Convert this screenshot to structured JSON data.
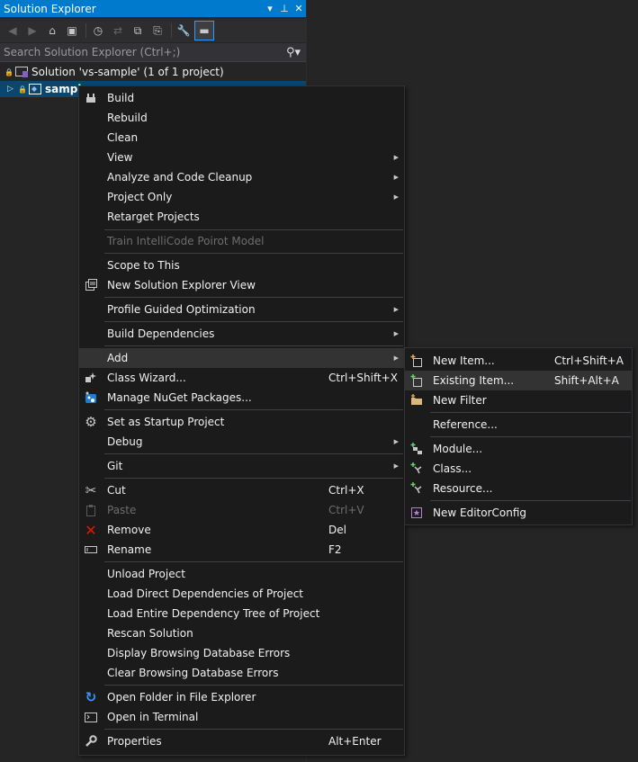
{
  "panel": {
    "title": "Solution Explorer",
    "search_placeholder": "Search Solution Explorer (Ctrl+;)",
    "tree": {
      "solution": "Solution 'vs-sample' (1 of 1 project)",
      "project": "sampl"
    }
  },
  "context_menu": {
    "items": [
      {
        "label": "Build"
      },
      {
        "label": "Rebuild"
      },
      {
        "label": "Clean"
      },
      {
        "label": "View"
      },
      {
        "label": "Analyze and Code Cleanup"
      },
      {
        "label": "Project Only"
      },
      {
        "label": "Retarget Projects"
      },
      {
        "label": "Train IntelliCode Poirot Model"
      },
      {
        "label": "Scope to This"
      },
      {
        "label": "New Solution Explorer View"
      },
      {
        "label": "Profile Guided Optimization"
      },
      {
        "label": "Build Dependencies"
      },
      {
        "label": "Add"
      },
      {
        "label": "Class Wizard...",
        "shortcut": "Ctrl+Shift+X"
      },
      {
        "label": "Manage NuGet Packages..."
      },
      {
        "label": "Set as Startup Project"
      },
      {
        "label": "Debug"
      },
      {
        "label": "Git"
      },
      {
        "label": "Cut",
        "shortcut": "Ctrl+X"
      },
      {
        "label": "Paste",
        "shortcut": "Ctrl+V"
      },
      {
        "label": "Remove",
        "shortcut": "Del"
      },
      {
        "label": "Rename",
        "shortcut": "F2"
      },
      {
        "label": "Unload Project"
      },
      {
        "label": "Load Direct Dependencies of Project"
      },
      {
        "label": "Load Entire Dependency Tree of Project"
      },
      {
        "label": "Rescan Solution"
      },
      {
        "label": "Display Browsing Database Errors"
      },
      {
        "label": "Clear Browsing Database Errors"
      },
      {
        "label": "Open Folder in File Explorer"
      },
      {
        "label": "Open in Terminal"
      },
      {
        "label": "Properties",
        "shortcut": "Alt+Enter"
      }
    ]
  },
  "add_submenu": {
    "items": [
      {
        "label": "New Item...",
        "shortcut": "Ctrl+Shift+A"
      },
      {
        "label": "Existing Item...",
        "shortcut": "Shift+Alt+A"
      },
      {
        "label": "New Filter"
      },
      {
        "label": "Reference..."
      },
      {
        "label": "Module..."
      },
      {
        "label": "Class..."
      },
      {
        "label": "Resource..."
      },
      {
        "label": "New EditorConfig"
      }
    ]
  },
  "colors": {
    "accent": "#007acc",
    "selection": "#094771",
    "menu_bg": "#1b1b1c",
    "highlight": "#333334",
    "remove_icon": "#e51400"
  }
}
